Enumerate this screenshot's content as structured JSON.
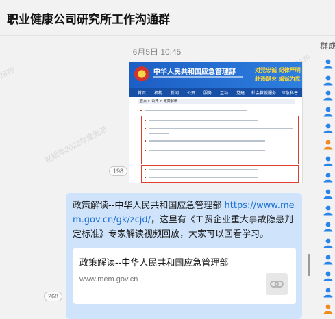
{
  "window": {
    "title": "职业健康公司研究所工作沟通群"
  },
  "sidebar": {
    "title": "群成"
  },
  "chat": {
    "timestamp": "6月5日 10:45",
    "image_message": {
      "count_badge": "198",
      "org_name": "中华人民共和国应急管理部",
      "slogans": [
        "对党忠诚",
        "纪律严明",
        "赴汤蹈火",
        "竭诚为民"
      ],
      "nav_items": [
        "首页",
        "机构",
        "新闻",
        "公开",
        "服务",
        "互动",
        "党建",
        "社会救援服务",
        "应急科普"
      ],
      "breadcrumb": "首页 > 公开 > 政策解读"
    },
    "text_message": {
      "count_badge": "268",
      "prefix": "政策解读--中华人民共和国应急管理部 ",
      "link": "https://www.mem.gov.cn/gk/zcjd/",
      "suffix": "，这里有《工贸企业重大事故隐患判定标准》专家解读视频回放，大家可以回看学习。",
      "card": {
        "title": "政策解读--中华人民共和国应急管理部",
        "domain": "www.mem.gov.cn",
        "thumb_icon": "link-chain-icon"
      }
    },
    "watermark_text": "赵娟年2022年度先进个人2876"
  },
  "colors": {
    "bubble": "#cfe3fb",
    "link": "#1a6fd1",
    "member_icon": "#2b84e8",
    "member_icon_alt": "#f08a24"
  }
}
